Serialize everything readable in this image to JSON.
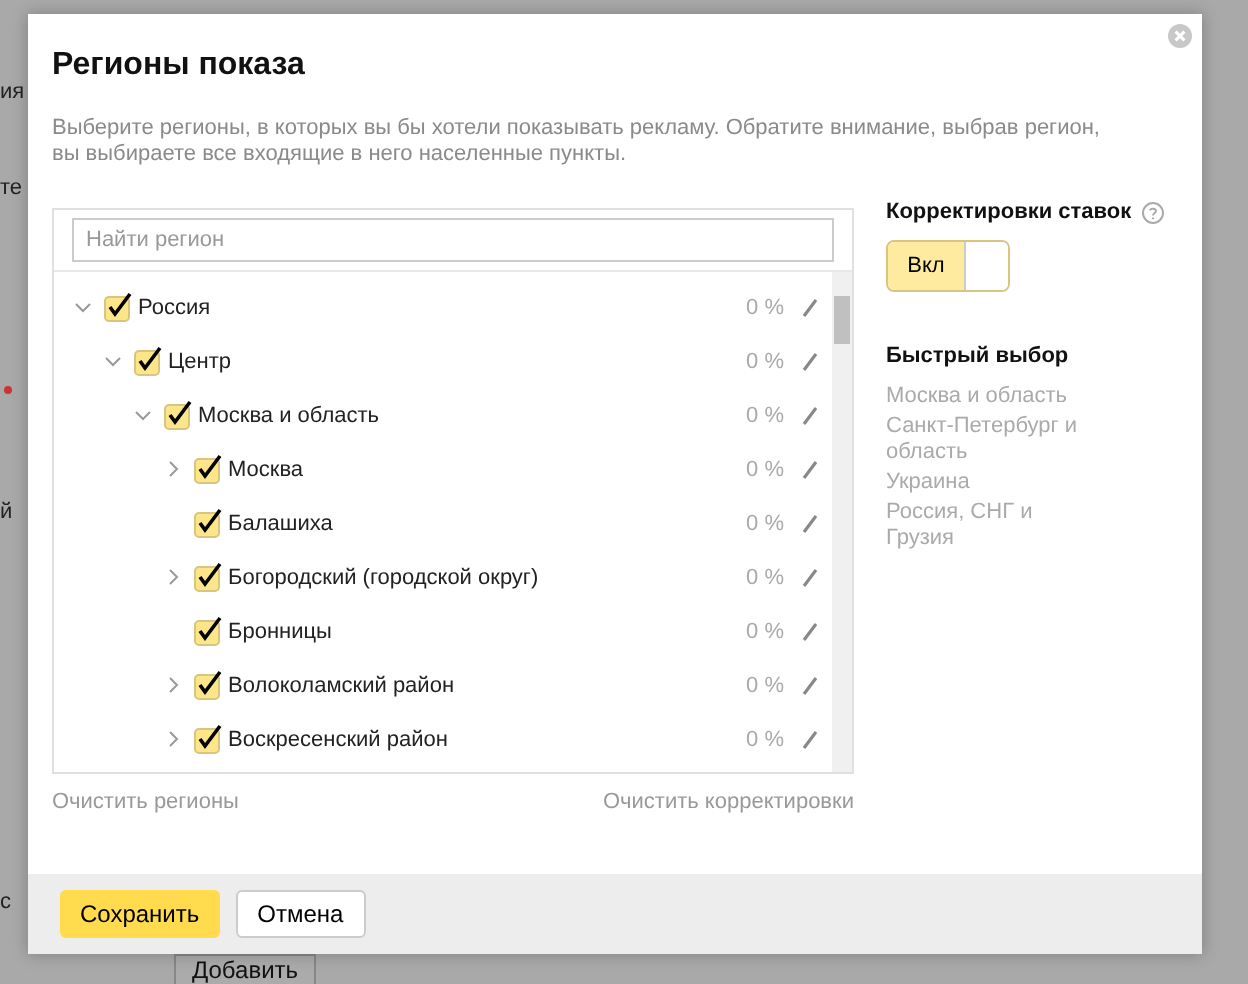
{
  "background": {
    "fragments": [
      "ия",
      "те",
      "й",
      "с"
    ],
    "add_button": "Добавить"
  },
  "dialog": {
    "title": "Регионы показа",
    "description": "Выберите регионы, в которых вы бы хотели показывать рекламу. Обратите внимание, выбрав регион, вы выбираете все входящие в него населенные пункты.",
    "search": {
      "placeholder": "Найти регион"
    },
    "tree": [
      {
        "label": "Россия",
        "checked": true,
        "expanded": true,
        "percent": "0 %",
        "children": [
          {
            "label": "Центр",
            "checked": true,
            "expanded": true,
            "percent": "0 %",
            "children": [
              {
                "label": "Москва и область",
                "checked": true,
                "expanded": true,
                "percent": "0 %",
                "children": [
                  {
                    "label": "Москва",
                    "checked": true,
                    "expanded": false,
                    "percent": "0 %"
                  },
                  {
                    "label": "Балашиха",
                    "checked": true,
                    "percent": "0 %"
                  },
                  {
                    "label": "Богородский (городской округ)",
                    "checked": true,
                    "expanded": false,
                    "percent": "0 %"
                  },
                  {
                    "label": "Бронницы",
                    "checked": true,
                    "percent": "0 %"
                  },
                  {
                    "label": "Волоколамский район",
                    "checked": true,
                    "expanded": false,
                    "percent": "0 %"
                  },
                  {
                    "label": "Воскресенский район",
                    "checked": true,
                    "expanded": false,
                    "percent": "0 %"
                  }
                ]
              }
            ]
          }
        ]
      }
    ],
    "clear_regions": "Очистить регионы",
    "clear_adjustments": "Очистить корректировки",
    "bid_adjustments": {
      "title": "Корректировки ставок",
      "toggle": {
        "label": "Вкл",
        "on": true
      }
    },
    "quick_select": {
      "title": "Быстрый выбор",
      "items": [
        "Москва и область",
        "Санкт-Петербург и область",
        "Украина",
        "Россия, СНГ и Грузия"
      ]
    },
    "buttons": {
      "save": "Сохранить",
      "cancel": "Отмена"
    }
  }
}
